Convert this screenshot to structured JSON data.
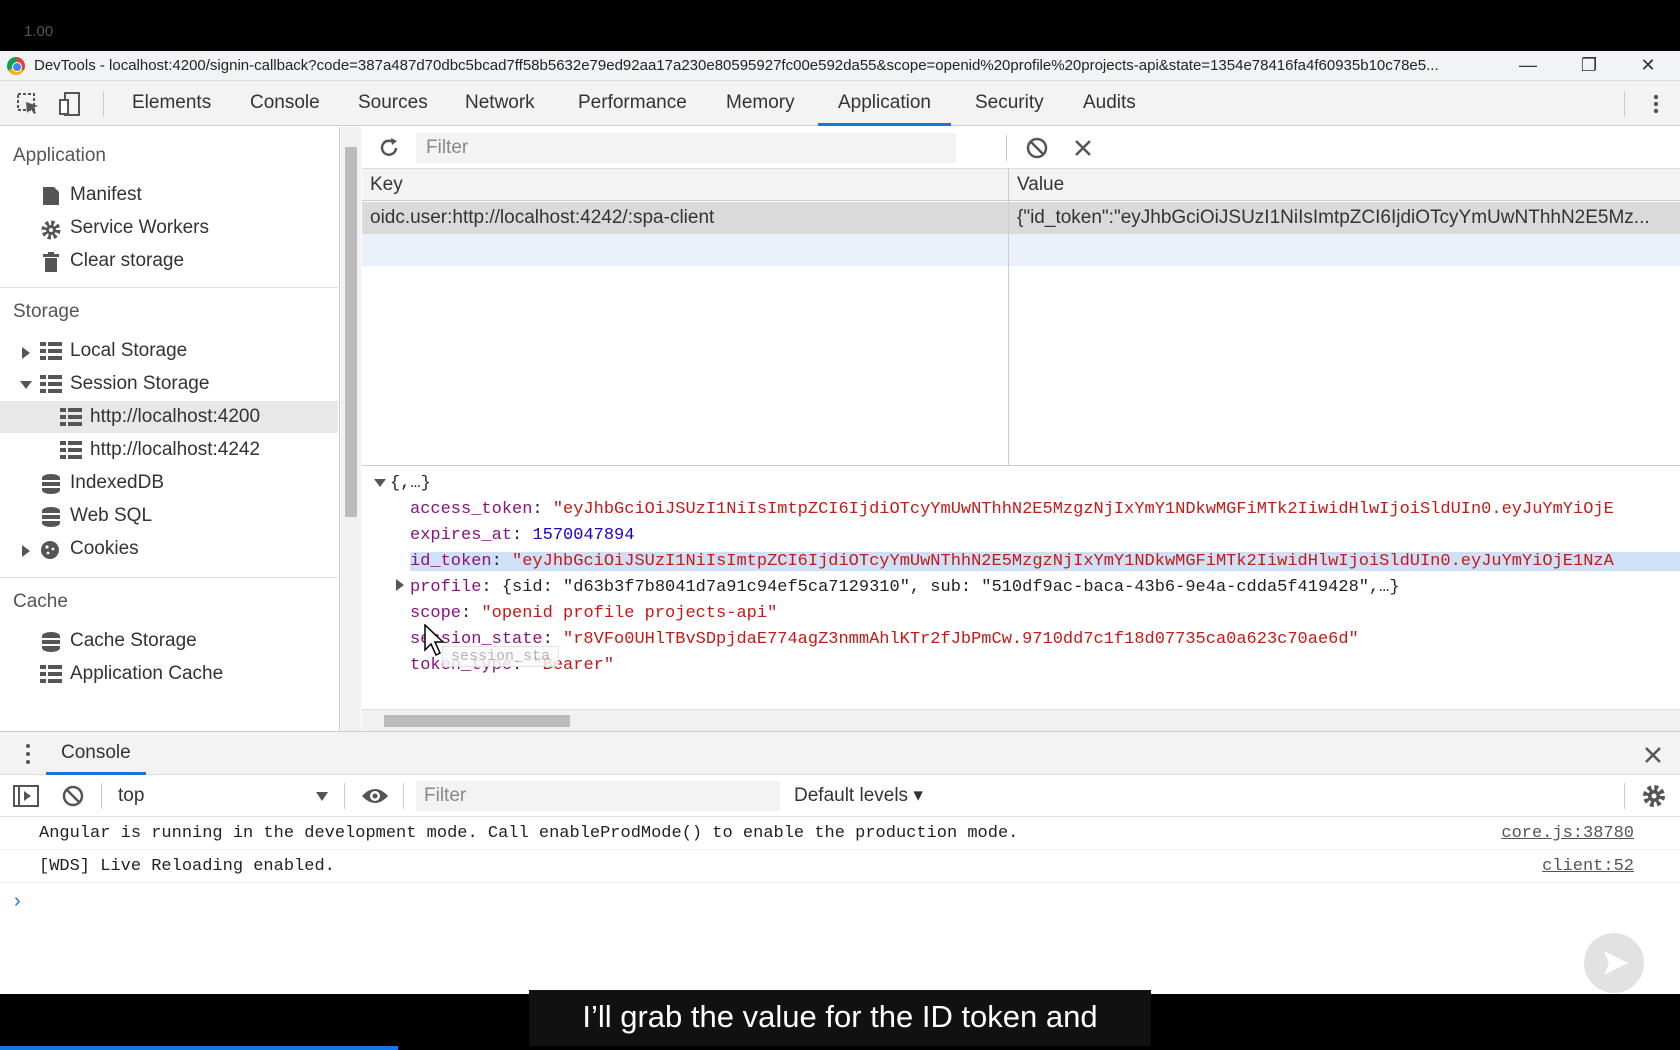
{
  "overlay": {
    "zoom": "1.00",
    "caption": "I’ll grab the value for the ID token and"
  },
  "window": {
    "title": "DevTools - localhost:4200/signin-callback?code=387a487d70dbc5bcad7ff58b5632e79ed92aa17a230e80595927fc00e592da55&scope=openid%20profile%20projects-api&state=1354e78416fa4f60935b10c78e5...",
    "minimize": "—",
    "restore": "❐",
    "close": "✕"
  },
  "tabs": [
    "Elements",
    "Console",
    "Sources",
    "Network",
    "Performance",
    "Memory",
    "Application",
    "Security",
    "Audits"
  ],
  "sidebar": {
    "application_header": "Application",
    "application_items": [
      "Manifest",
      "Service Workers",
      "Clear storage"
    ],
    "storage_header": "Storage",
    "storage_items": [
      "Local Storage",
      "Session Storage",
      "http://localhost:4200",
      "http://localhost:4242",
      "IndexedDB",
      "Web SQL",
      "Cookies"
    ],
    "cache_header": "Cache",
    "cache_items": [
      "Cache Storage",
      "Application Cache"
    ]
  },
  "storage_view": {
    "filter_placeholder": "Filter",
    "col_key": "Key",
    "col_value": "Value",
    "row_key": "oidc.user:http://localhost:4242/:spa-client",
    "row_value": "{\"id_token\":\"eyJhbGciOiJSUzI1NiIsImtpZCI6IjdiOTcyYmUwNThhN2E5Mz..."
  },
  "preview": {
    "root": "{,…}",
    "access_token_key": "access_token",
    "access_token_val": "\"eyJhbGciOiJSUzI1NiIsImtpZCI6IjdiOTcyYmUwNThhN2E5MzgzNjIxYmY1NDkwMGFiMTk2IiwidHlwIjoiSldUIn0.eyJuYmYiOjE",
    "expires_at_key": "expires_at",
    "expires_at_val": "1570047894",
    "id_token_key": "id_token",
    "id_token_val": "\"eyJhbGciOiJSUzI1NiIsImtpZCI6IjdiOTcyYmUwNThhN2E5MzgzNjIxYmY1NDkwMGFiMTk2IiwidHlwIjoiSldUIn0.eyJuYmYiOjE1NzA",
    "profile_key": "profile",
    "profile_val": "{sid: \"d63b3f7b8041d7a91c94ef5ca7129310\", sub: \"510df9ac-baca-43b6-9e4a-cdda5f419428\",…}",
    "scope_key": "scope",
    "scope_val": "\"openid profile projects-api\"",
    "session_state_key": "session_state",
    "session_state_val": "\"r8VFo0UHlTBvSDpjdaE774agZ3nmmAhlKTr2fJbPmCw.9710dd7c1f18d07735ca0a623c70ae6d\"",
    "token_type_key": "token_type",
    "token_type_val": "\"Bearer\"",
    "tooltip": "session_sta"
  },
  "console": {
    "tab_label": "Console",
    "context": "top",
    "filter_placeholder": "Filter",
    "levels": "Default levels ▾",
    "messages": [
      {
        "text": "Angular is running in the development mode. Call enableProdMode() to enable the production mode.",
        "source": "core.js:38780"
      },
      {
        "text": "[WDS] Live Reloading enabled.",
        "source": "client:52"
      }
    ],
    "prompt": "›"
  },
  "colors": {
    "accent": "#1a73e8",
    "key": "#881280",
    "string": "#c41a16",
    "number": "#1c00cf"
  }
}
